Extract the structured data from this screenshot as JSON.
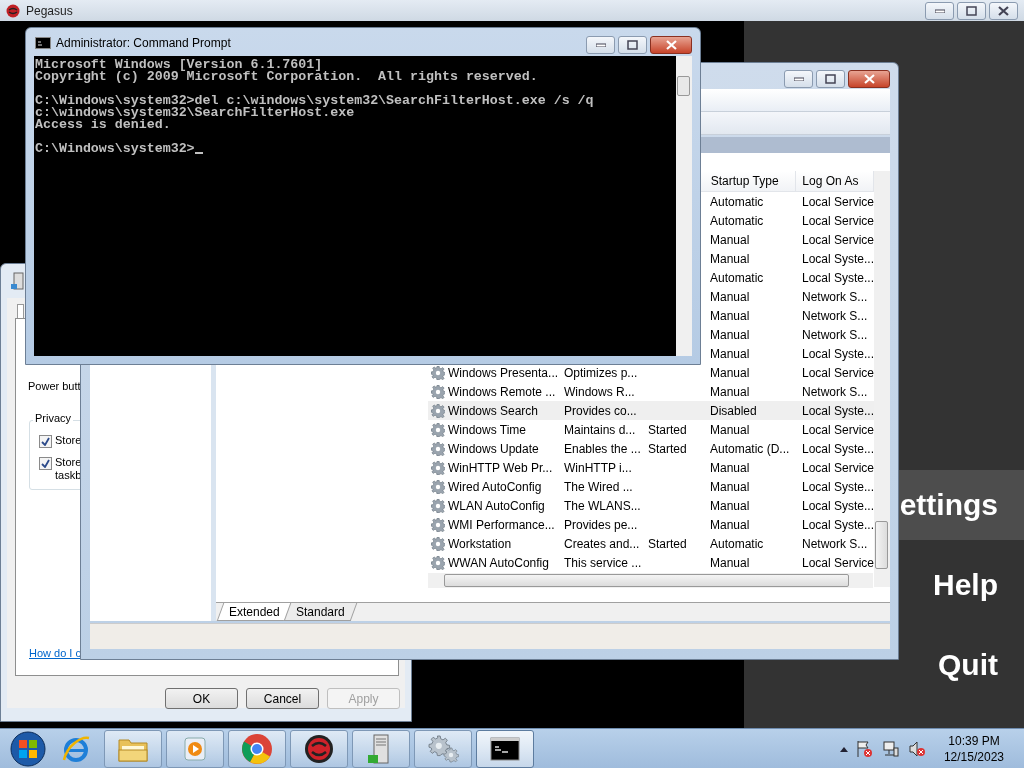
{
  "app": {
    "title": "Pegasus",
    "menu": [
      {
        "label": "ettings",
        "selected": true
      },
      {
        "label": "Help",
        "selected": false
      },
      {
        "label": "Quit",
        "selected": false
      }
    ]
  },
  "dialog": {
    "power_label": "Power butt",
    "privacy_group": "Privacy",
    "checkboxes": [
      {
        "label": "Store",
        "checked": true
      },
      {
        "label": "Store\ntaskb",
        "checked": true
      }
    ],
    "link": "How do I c",
    "buttons": [
      {
        "label": "OK",
        "disabled": false
      },
      {
        "label": "Cancel",
        "disabled": false
      },
      {
        "label": "Apply",
        "disabled": true
      }
    ]
  },
  "services": {
    "columns": [
      "Startup Type",
      "Log On As"
    ],
    "rows": [
      {
        "startup_type": "Automatic",
        "log_on_as": "Local Service",
        "selected": false
      },
      {
        "startup_type": "Automatic",
        "log_on_as": "Local Service",
        "selected": false
      },
      {
        "startup_type": "Manual",
        "log_on_as": "Local Service",
        "selected": false
      },
      {
        "startup_type": "Manual",
        "log_on_as": "Local Syste...",
        "selected": false
      },
      {
        "startup_type": "Automatic",
        "log_on_as": "Local Syste...",
        "selected": false
      },
      {
        "startup_type": "Manual",
        "log_on_as": "Network S...",
        "selected": false
      },
      {
        "startup_type": "Manual",
        "log_on_as": "Network S...",
        "selected": false
      },
      {
        "startup_type": "Manual",
        "log_on_as": "Network S...",
        "selected": false
      },
      {
        "startup_type": "Manual",
        "log_on_as": "Local Syste...",
        "selected": false
      },
      {
        "name": "Windows Presenta...",
        "description": "Optimizes p...",
        "startup_type": "Manual",
        "log_on_as": "Local Service",
        "selected": false
      },
      {
        "name": "Windows Remote ...",
        "description": "Windows R...",
        "startup_type": "Manual",
        "log_on_as": "Network S...",
        "selected": false
      },
      {
        "name": "Windows Search",
        "description": "Provides co...",
        "startup_type": "Disabled",
        "log_on_as": "Local Syste...",
        "selected": true
      },
      {
        "name": "Windows Time",
        "description": "Maintains d...",
        "status": "Started",
        "startup_type": "Manual",
        "log_on_as": "Local Service",
        "selected": false
      },
      {
        "name": "Windows Update",
        "description": "Enables the ...",
        "status": "Started",
        "startup_type": "Automatic (D...",
        "log_on_as": "Local Syste...",
        "selected": false
      },
      {
        "name": "WinHTTP Web Pr...",
        "description": "WinHTTP i...",
        "startup_type": "Manual",
        "log_on_as": "Local Service",
        "selected": false
      },
      {
        "name": "Wired AutoConfig",
        "description": "The Wired ...",
        "startup_type": "Manual",
        "log_on_as": "Local Syste...",
        "selected": false
      },
      {
        "name": "WLAN AutoConfig",
        "description": "The WLANS...",
        "startup_type": "Manual",
        "log_on_as": "Local Syste...",
        "selected": false
      },
      {
        "name": "WMI Performance...",
        "description": "Provides pe...",
        "startup_type": "Manual",
        "log_on_as": "Local Syste...",
        "selected": false
      },
      {
        "name": "Workstation",
        "description": "Creates and...",
        "status": "Started",
        "startup_type": "Automatic",
        "log_on_as": "Network S...",
        "selected": false
      },
      {
        "name": "WWAN AutoConfig",
        "description": "This service ...",
        "startup_type": "Manual",
        "log_on_as": "Local Service",
        "selected": false
      }
    ],
    "tabs": [
      {
        "label": "Extended",
        "selected": true
      },
      {
        "label": "Standard",
        "selected": false
      }
    ]
  },
  "cmd": {
    "title": "Administrator:  Command Prompt",
    "blocks": [
      [
        "Microsoft Windows [Version 6.1.7601]",
        "Copyright (c) 2009 Microsoft Corporation.  All rights reserved."
      ],
      [
        "C:\\Windows\\system32>del c:\\windows\\system32\\SearchFilterHost.exe /s /q",
        "c:\\windows\\system32\\SearchFilterHost.exe",
        "Access is denied."
      ],
      [
        "C:\\Windows\\system32>"
      ]
    ],
    "cursor": true
  },
  "taskbar": {
    "apps": [
      {
        "kind": "browser",
        "running": false,
        "selected": false
      },
      {
        "kind": "folder",
        "running": true,
        "selected": false
      },
      {
        "kind": "media",
        "running": true,
        "selected": false
      },
      {
        "kind": "chrome",
        "running": true,
        "selected": false
      },
      {
        "kind": "pegasus",
        "running": true,
        "selected": false
      },
      {
        "kind": "server",
        "running": true,
        "selected": false
      },
      {
        "kind": "gears",
        "running": true,
        "selected": false
      },
      {
        "kind": "console",
        "running": true,
        "selected": true
      }
    ],
    "time": "10:39 PM",
    "date": "12/15/2023"
  }
}
